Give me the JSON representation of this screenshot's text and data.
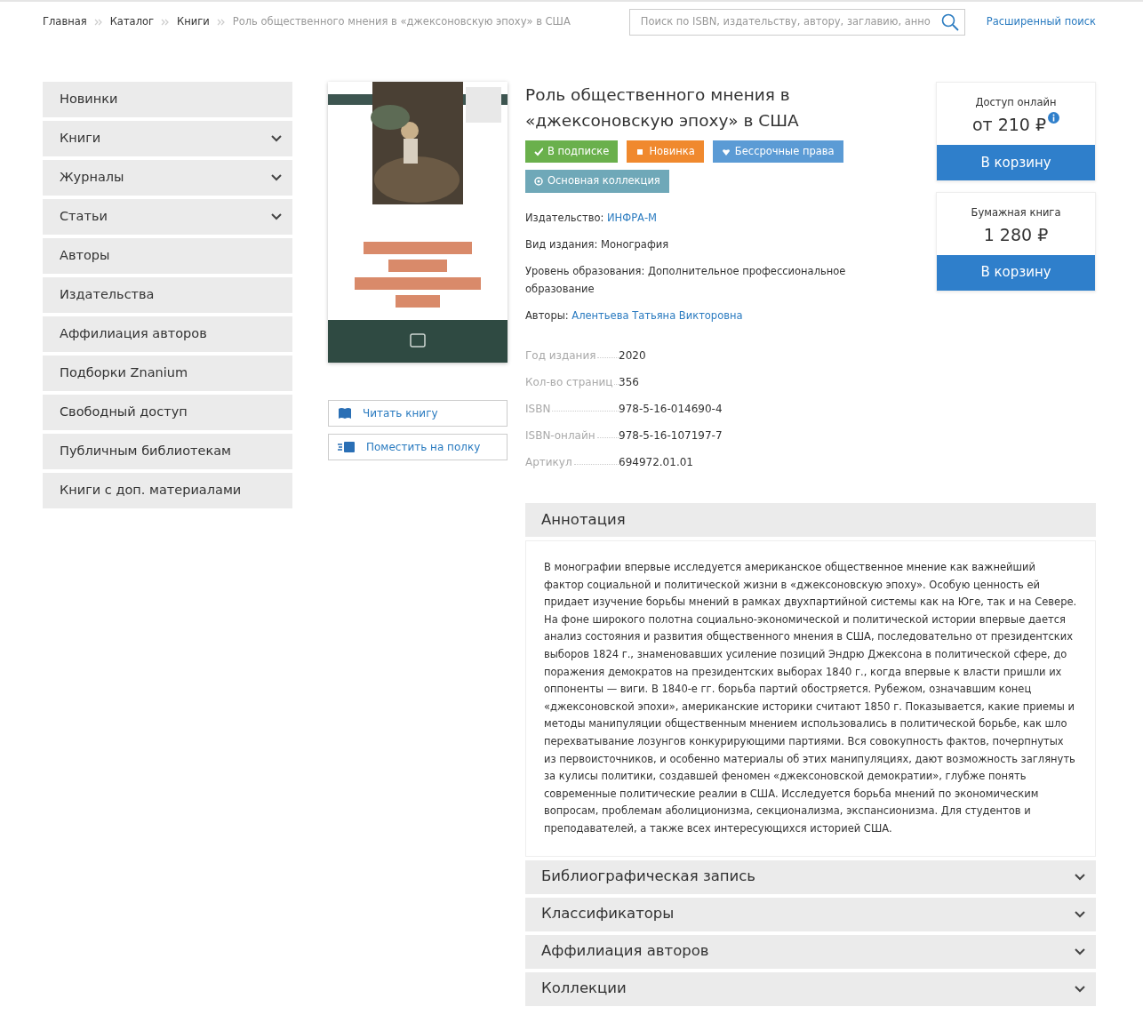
{
  "breadcrumbs": [
    {
      "label": "Главная",
      "current": false
    },
    {
      "label": "Каталог",
      "current": false
    },
    {
      "label": "Книги",
      "current": false
    },
    {
      "label": "Роль общественного мнения в «джексоновскую эпоху» в США",
      "current": true
    }
  ],
  "search": {
    "placeholder": "Поиск по ISBN, издательству, автору, заглавию, анно",
    "advanced_link": "Расширенный поиск"
  },
  "sidebar": {
    "items": [
      {
        "label": "Новинки",
        "kind": "link"
      },
      {
        "label": "Книги",
        "kind": "dropdown"
      },
      {
        "label": "Журналы",
        "kind": "dropdown"
      },
      {
        "label": "Статьи",
        "kind": "dropdown"
      },
      {
        "label": "Авторы",
        "kind": "link"
      },
      {
        "label": "Издательства",
        "kind": "link"
      },
      {
        "label": "Аффилиация авторов",
        "kind": "link"
      },
      {
        "label": "Подборки Znanium",
        "kind": "link"
      },
      {
        "label": "Свободный доступ",
        "kind": "link"
      },
      {
        "label": "Публичным библиотекам",
        "kind": "link"
      },
      {
        "label": "Книги с доп. материалами",
        "kind": "link"
      }
    ]
  },
  "actions": [
    {
      "label": "Читать книгу",
      "kind": "read"
    },
    {
      "label": "Поместить на полку",
      "kind": "shelf"
    }
  ],
  "book": {
    "title": "Роль общественного мнения в «джексоновскую эпоху» в США",
    "badges": [
      {
        "label": "В подписке",
        "kind": "check",
        "color": "#6ab04c"
      },
      {
        "label": "Новинка",
        "kind": "square",
        "color": "#f0892e"
      },
      {
        "label": "Бессрочные права",
        "kind": "heart",
        "color": "#5b9bd5"
      },
      {
        "label": "Основная коллекция",
        "kind": "circle",
        "color": "#6fa8b8"
      }
    ],
    "details": [
      {
        "label": "Издательство:",
        "value": "ИНФРА-М",
        "link": true
      },
      {
        "label": "Вид издания:",
        "value": "Монография",
        "link": false
      },
      {
        "label": "Уровень образования:",
        "value": "Дополнительное профессиональное образование",
        "link": false
      },
      {
        "label": "Авторы:",
        "value": "Алентьева Татьяна Викторовна",
        "link": true
      }
    ],
    "facts": [
      {
        "label": "Год издания",
        "value": "2020"
      },
      {
        "label": "Кол-во страниц",
        "value": "356"
      },
      {
        "label": "ISBN",
        "value": "978-5-16-014690-4"
      },
      {
        "label": "ISBN-онлайн",
        "value": "978-5-16-107197-7"
      },
      {
        "label": "Артикул",
        "value": "694972.01.01"
      }
    ]
  },
  "offers": [
    {
      "label": "Доступ онлайн",
      "price": "от 210 ₽",
      "info": true,
      "button": "В корзину"
    },
    {
      "label": "Бумажная книга",
      "price": "1 280 ₽",
      "info": false,
      "button": "В корзину"
    }
  ],
  "sections": [
    {
      "title": "Аннотация",
      "expanded": true,
      "text": "В монографии впервые исследуется американское общественное мнение как важнейший фактор социальной и политической жизни в «джексоновскую эпоху». Особую ценность ей придает изучение борьбы мнений в рамках двухпартийной системы как на Юге, так и на Севере. На фоне широкого полотна социально-экономической и политической истории впервые дается анализ состояния и развития общественного мнения в США, последовательно от президентских выборов 1824 г., знаменовавших усиление позиций Эндрю Джексона в политической сфере, до поражения демократов на президентских выборах 1840 г., когда впервые к власти пришли их оппоненты — виги. В 1840-е гг. борьба партий обостряется. Рубежом, означавшим конец «джексоновской эпохи», американские историки считают 1850 г. Показывается, какие приемы и методы манипуляции общественным мнением использовались в политической борьбе, как шло перехватывание лозунгов конкурирующими партиями. Вся совокупность фактов, почерпнутых из первоисточников, и особенно материалы об этих манипуляциях, дают возможность заглянуть за кулисы политики, создавшей феномен «джексоновской демократии», глубже понять современные политические реалии в США. Исследуется борьба мнений по экономическим вопросам, проблемам аболиционизма, секционализма, экспансионизма. Для студентов и преподавателей, а также всех интересующихся историей США."
    },
    {
      "title": "Библиографическая запись",
      "expanded": false
    },
    {
      "title": "Классификаторы",
      "expanded": false
    },
    {
      "title": "Аффилиация авторов",
      "expanded": false
    },
    {
      "title": "Коллекции",
      "expanded": false
    }
  ]
}
